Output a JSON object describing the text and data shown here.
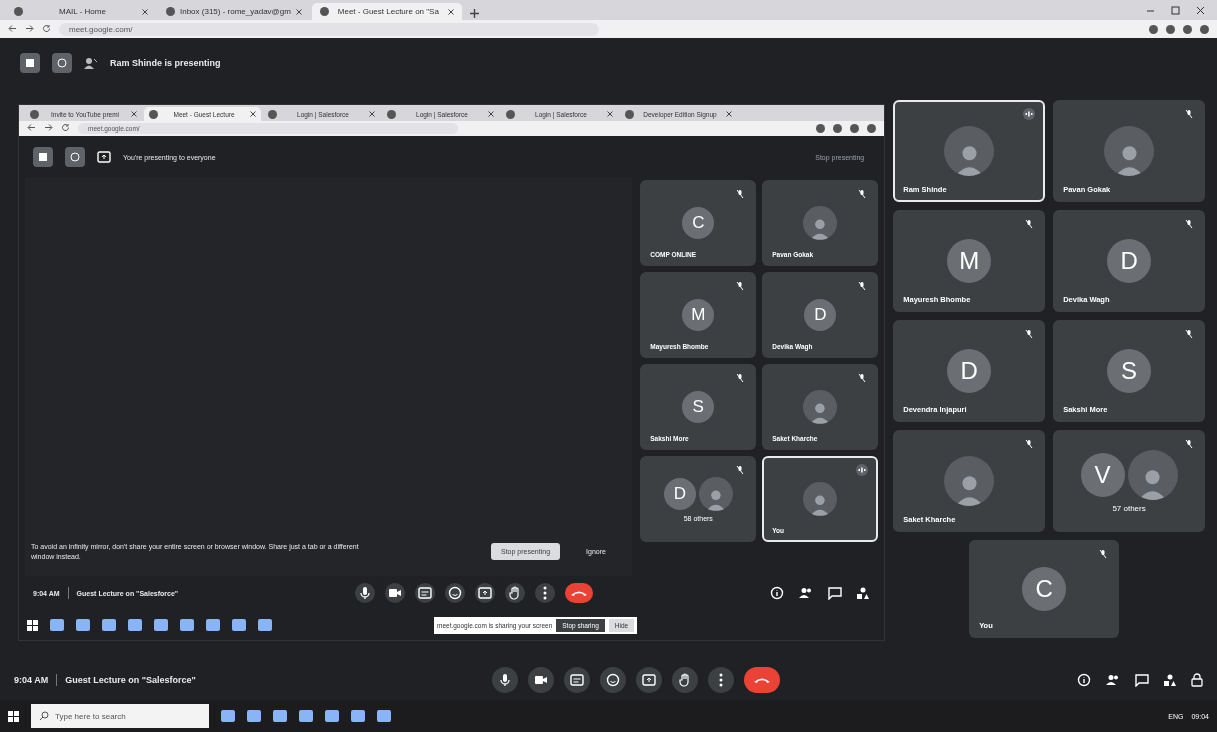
{
  "browser": {
    "tabs": [
      {
        "title": "MAIL - Home",
        "selected": false
      },
      {
        "title": "Inbox (315) - rome_yadav@gm",
        "selected": false
      },
      {
        "title": "Meet - Guest Lecture on \"Sa",
        "selected": true
      }
    ],
    "url": "meet.google.com/"
  },
  "meet_bar": {
    "presenter_text": "Ram Shinde is presenting"
  },
  "presentation": {
    "browser": {
      "tabs": [
        {
          "title": "Invite to YouTube premi",
          "selected": false
        },
        {
          "title": "Meet - Guest Lecture",
          "selected": true
        },
        {
          "title": "Login | Salesforce",
          "selected": false
        },
        {
          "title": "Login | Salesforce",
          "selected": false
        },
        {
          "title": "Login | Salesforce",
          "selected": false
        },
        {
          "title": "Developer Edition Signup",
          "selected": false
        }
      ],
      "url": "meet.google.com/"
    },
    "presenting_text": "You're presenting to everyone",
    "stop_presenting": "Stop presenting",
    "tiles": [
      {
        "kind": "initial",
        "name": "COMP ONLINE",
        "initial": "C",
        "muted": true,
        "selected": false
      },
      {
        "kind": "photo",
        "name": "Pavan Gokak",
        "muted": true,
        "selected": false
      },
      {
        "kind": "initial",
        "name": "Mayuresh Bhombe",
        "initial": "M",
        "muted": true,
        "selected": false
      },
      {
        "kind": "initial",
        "name": "Devika Wagh",
        "initial": "D",
        "muted": true,
        "selected": false
      },
      {
        "kind": "initial",
        "name": "Sakshi More",
        "initial": "S",
        "muted": true,
        "selected": false
      },
      {
        "kind": "photo",
        "name": "Saket Kharche",
        "muted": true,
        "selected": false
      },
      {
        "kind": "others",
        "name": "58 others",
        "initial": "D",
        "muted": true,
        "selected": false
      },
      {
        "kind": "photo",
        "name": "You",
        "muted": false,
        "selected": true
      }
    ],
    "warning": {
      "text": "To avoid an infinity mirror, don't share your entire screen or browser window. Share just a tab or a different window instead.",
      "stop_button": "Stop presenting",
      "ignore_button": "Ignore"
    },
    "bottom_bar": {
      "time": "9:04 AM",
      "meeting_title": "Guest Lecture on \"Salesforce\""
    },
    "share_notice": {
      "text": "meet.google.com is sharing your screen",
      "stop_button": "Stop sharing",
      "hide_button": "Hide"
    }
  },
  "tiles": [
    {
      "kind": "photo",
      "name": "Ram Shinde",
      "muted": false,
      "selected": true
    },
    {
      "kind": "photo",
      "name": "Pavan Gokak",
      "muted": true,
      "selected": false
    },
    {
      "kind": "initial",
      "name": "Mayuresh Bhombe",
      "initial": "M",
      "muted": true,
      "selected": false
    },
    {
      "kind": "initial",
      "name": "Devika Wagh",
      "initial": "D",
      "muted": true,
      "selected": false
    },
    {
      "kind": "initial",
      "name": "Devendra Injapuri",
      "initial": "D",
      "muted": true,
      "selected": false
    },
    {
      "kind": "initial",
      "name": "Sakshi More",
      "initial": "S",
      "muted": true,
      "selected": false
    },
    {
      "kind": "photo",
      "name": "Saket Kharche",
      "muted": true,
      "selected": false
    },
    {
      "kind": "others",
      "name": "57 others",
      "initial": "V",
      "muted": true,
      "selected": false
    }
  ],
  "self_tile": {
    "kind": "initial",
    "name": "You",
    "initial": "C",
    "muted": true,
    "selected": false
  },
  "bottom_bar": {
    "time": "9:04 AM",
    "meeting_title": "Guest Lecture on \"Salesforce\""
  },
  "taskbar": {
    "search_placeholder": "Type here to search",
    "language": "ENG",
    "time": "09:04"
  }
}
